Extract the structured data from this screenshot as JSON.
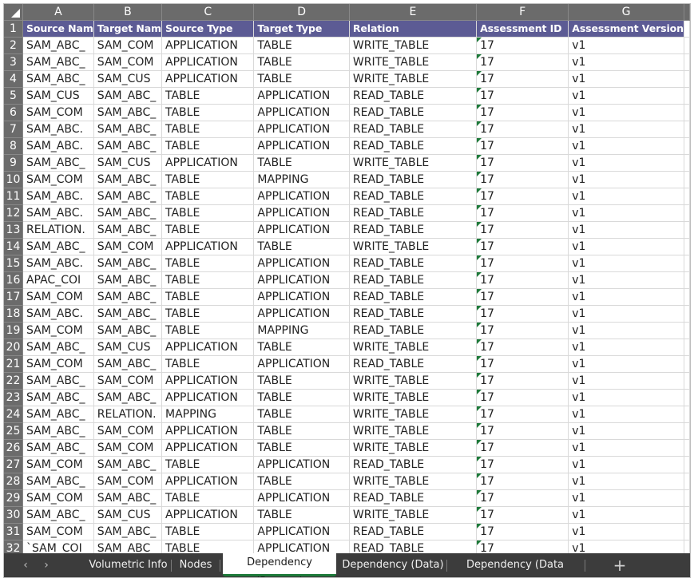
{
  "columns": [
    "A",
    "B",
    "C",
    "D",
    "E",
    "F",
    "G"
  ],
  "header_row_number": "1",
  "headers": [
    "Source Nam",
    "Target Nam",
    "Source Type",
    "Target Type",
    "Relation",
    "Assessment ID",
    "Assessment Version"
  ],
  "rows": [
    {
      "n": "2",
      "a": "SAM_ABC_",
      "b": "SAM_COM",
      "c": "APPLICATION",
      "d": "TABLE",
      "e": "WRITE_TABLE",
      "f": "17",
      "g": "v1"
    },
    {
      "n": "3",
      "a": "SAM_ABC_",
      "b": "SAM_COM",
      "c": "APPLICATION",
      "d": "TABLE",
      "e": "WRITE_TABLE",
      "f": "17",
      "g": "v1"
    },
    {
      "n": "4",
      "a": "SAM_ABC_",
      "b": "SAM_CUS",
      "c": "APPLICATION",
      "d": "TABLE",
      "e": "WRITE_TABLE",
      "f": "17",
      "g": "v1"
    },
    {
      "n": "5",
      "a": "SAM_CUS",
      "b": "SAM_ABC_",
      "c": "TABLE",
      "d": "APPLICATION",
      "e": "READ_TABLE",
      "f": "17",
      "g": "v1"
    },
    {
      "n": "6",
      "a": "SAM_COM",
      "b": "SAM_ABC_",
      "c": "TABLE",
      "d": "APPLICATION",
      "e": "READ_TABLE",
      "f": "17",
      "g": "v1"
    },
    {
      "n": "7",
      "a": "SAM_ABC.",
      "b": "SAM_ABC_",
      "c": "TABLE",
      "d": "APPLICATION",
      "e": "READ_TABLE",
      "f": "17",
      "g": "v1"
    },
    {
      "n": "8",
      "a": "SAM_ABC.",
      "b": "SAM_ABC_",
      "c": "TABLE",
      "d": "APPLICATION",
      "e": "READ_TABLE",
      "f": "17",
      "g": "v1"
    },
    {
      "n": "9",
      "a": "SAM_ABC_",
      "b": "SAM_CUS",
      "c": "APPLICATION",
      "d": "TABLE",
      "e": "WRITE_TABLE",
      "f": "17",
      "g": "v1"
    },
    {
      "n": "10",
      "a": "SAM_COM",
      "b": "SAM_ABC_",
      "c": "TABLE",
      "d": "MAPPING",
      "e": "READ_TABLE",
      "f": "17",
      "g": "v1"
    },
    {
      "n": "11",
      "a": "SAM_ABC.",
      "b": "SAM_ABC_",
      "c": "TABLE",
      "d": "APPLICATION",
      "e": "READ_TABLE",
      "f": "17",
      "g": "v1"
    },
    {
      "n": "12",
      "a": "SAM_ABC.",
      "b": "SAM_ABC_",
      "c": "TABLE",
      "d": "APPLICATION",
      "e": "READ_TABLE",
      "f": "17",
      "g": "v1"
    },
    {
      "n": "13",
      "a": "RELATION.",
      "b": "SAM_ABC_",
      "c": "TABLE",
      "d": "APPLICATION",
      "e": "READ_TABLE",
      "f": "17",
      "g": "v1"
    },
    {
      "n": "14",
      "a": "SAM_ABC_",
      "b": "SAM_COM",
      "c": "APPLICATION",
      "d": "TABLE",
      "e": "WRITE_TABLE",
      "f": "17",
      "g": "v1"
    },
    {
      "n": "15",
      "a": "SAM_ABC.",
      "b": "SAM_ABC_",
      "c": "TABLE",
      "d": "APPLICATION",
      "e": "READ_TABLE",
      "f": "17",
      "g": "v1"
    },
    {
      "n": "16",
      "a": "APAC_COI",
      "b": "SAM_ABC_",
      "c": "TABLE",
      "d": "APPLICATION",
      "e": "READ_TABLE",
      "f": "17",
      "g": "v1"
    },
    {
      "n": "17",
      "a": "SAM_COM",
      "b": "SAM_ABC_",
      "c": "TABLE",
      "d": "APPLICATION",
      "e": "READ_TABLE",
      "f": "17",
      "g": "v1"
    },
    {
      "n": "18",
      "a": "SAM_ABC.",
      "b": "SAM_ABC_",
      "c": "TABLE",
      "d": "APPLICATION",
      "e": "READ_TABLE",
      "f": "17",
      "g": "v1"
    },
    {
      "n": "19",
      "a": "SAM_COM",
      "b": "SAM_ABC_",
      "c": "TABLE",
      "d": "MAPPING",
      "e": "READ_TABLE",
      "f": "17",
      "g": "v1"
    },
    {
      "n": "20",
      "a": "SAM_ABC_",
      "b": "SAM_CUS",
      "c": "APPLICATION",
      "d": "TABLE",
      "e": "WRITE_TABLE",
      "f": "17",
      "g": "v1"
    },
    {
      "n": "21",
      "a": "SAM_COM",
      "b": "SAM_ABC_",
      "c": "TABLE",
      "d": "APPLICATION",
      "e": "READ_TABLE",
      "f": "17",
      "g": "v1"
    },
    {
      "n": "22",
      "a": "SAM_ABC_",
      "b": "SAM_COM",
      "c": "APPLICATION",
      "d": "TABLE",
      "e": "WRITE_TABLE",
      "f": "17",
      "g": "v1"
    },
    {
      "n": "23",
      "a": "SAM_ABC_",
      "b": "SAM_ABC_",
      "c": "APPLICATION",
      "d": "TABLE",
      "e": "WRITE_TABLE",
      "f": "17",
      "g": "v1"
    },
    {
      "n": "24",
      "a": "SAM_ABC_",
      "b": "RELATION.",
      "c": "MAPPING",
      "d": "TABLE",
      "e": "WRITE_TABLE",
      "f": "17",
      "g": "v1"
    },
    {
      "n": "25",
      "a": "SAM_ABC_",
      "b": "SAM_COM",
      "c": "APPLICATION",
      "d": "TABLE",
      "e": "WRITE_TABLE",
      "f": "17",
      "g": "v1"
    },
    {
      "n": "26",
      "a": "SAM_ABC_",
      "b": "SAM_COM",
      "c": "APPLICATION",
      "d": "TABLE",
      "e": "WRITE_TABLE",
      "f": "17",
      "g": "v1"
    },
    {
      "n": "27",
      "a": "SAM_COM",
      "b": "SAM_ABC_",
      "c": "TABLE",
      "d": "APPLICATION",
      "e": "READ_TABLE",
      "f": "17",
      "g": "v1"
    },
    {
      "n": "28",
      "a": "SAM_ABC_",
      "b": "SAM_COM",
      "c": "APPLICATION",
      "d": "TABLE",
      "e": "WRITE_TABLE",
      "f": "17",
      "g": "v1"
    },
    {
      "n": "29",
      "a": "SAM_COM",
      "b": "SAM_ABC_",
      "c": "TABLE",
      "d": "APPLICATION",
      "e": "READ_TABLE",
      "f": "17",
      "g": "v1"
    },
    {
      "n": "30",
      "a": "SAM_ABC_",
      "b": "SAM_CUS",
      "c": "APPLICATION",
      "d": "TABLE",
      "e": "WRITE_TABLE",
      "f": "17",
      "g": "v1"
    },
    {
      "n": "31",
      "a": "SAM_COM",
      "b": "SAM_ABC_",
      "c": "TABLE",
      "d": "APPLICATION",
      "e": "READ_TABLE",
      "f": "17",
      "g": "v1"
    },
    {
      "n": "32",
      "a": "`SAM_COI",
      "b": "SAM_ABC_",
      "c": "TABLE",
      "d": "APPLICATION",
      "e": "READ_TABLE",
      "f": "17",
      "g": "v1"
    }
  ],
  "sheet_tabs": [
    "Volumetric Info",
    "Nodes",
    "Dependency (Process)",
    "Dependency (Data)",
    "Dependency (Data Model)"
  ],
  "active_tab": "Dependency (Process)",
  "icons": {
    "prev": "chevron-left-icon",
    "next": "chevron-right-icon",
    "add": "plus-icon",
    "select_all": "select-all-triangle-icon"
  },
  "colors": {
    "header_fill": "#5c5b94",
    "grid_header": "#6b6b6b",
    "tab_bar": "#3c3c3c",
    "active_tab_underline": "#1e7a3a",
    "number_as_text_flag": "#1e7a3a"
  }
}
